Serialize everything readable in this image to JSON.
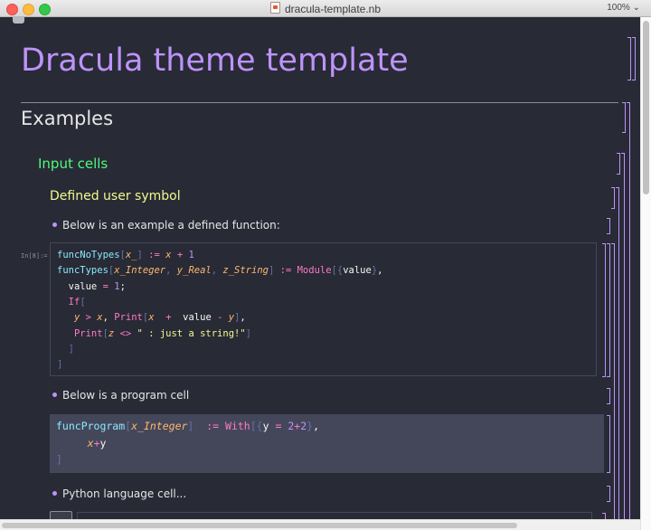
{
  "window": {
    "title": "dracula-template.nb",
    "zoom": "100%"
  },
  "notebook": {
    "title": "Dracula theme template",
    "section": "Examples",
    "subsection": "Input cells",
    "subsubsection": "Defined user symbol",
    "bullets": [
      "Below is an example a defined function:",
      "Below is a program cell",
      "Python language cell..."
    ],
    "in_label": "In[8]:="
  },
  "code1": [
    [
      [
        "fn",
        "funcNoTypes"
      ],
      [
        "gr",
        "["
      ],
      [
        "org",
        "x_"
      ],
      [
        "gr",
        "]"
      ],
      [
        "wt",
        " "
      ],
      [
        "pk",
        ":="
      ],
      [
        "wt",
        " "
      ],
      [
        "org",
        "x"
      ],
      [
        "wt",
        " "
      ],
      [
        "pk",
        "+"
      ],
      [
        "wt",
        " "
      ],
      [
        "pu",
        "1"
      ]
    ],
    [
      [
        "fn",
        "funcTypes"
      ],
      [
        "gr",
        "["
      ],
      [
        "org",
        "x_Integer"
      ],
      [
        "gr",
        ","
      ],
      [
        "wt",
        " "
      ],
      [
        "org",
        "y_Real"
      ],
      [
        "gr",
        ","
      ],
      [
        "wt",
        " "
      ],
      [
        "org",
        "z_String"
      ],
      [
        "gr",
        "]"
      ],
      [
        "wt",
        " "
      ],
      [
        "pk",
        ":="
      ],
      [
        "wt",
        " "
      ],
      [
        "pk",
        "Module"
      ],
      [
        "gr",
        "[{"
      ],
      [
        "wt",
        "value"
      ],
      [
        "gr",
        "}"
      ],
      [
        "wt",
        ","
      ]
    ],
    [
      [
        "wt",
        "  value "
      ],
      [
        "pk",
        "="
      ],
      [
        "wt",
        " "
      ],
      [
        "pu",
        "1"
      ],
      [
        "wt",
        ";"
      ]
    ],
    [
      [
        "wt",
        "  "
      ],
      [
        "pk",
        "If"
      ],
      [
        "gr",
        "["
      ]
    ],
    [
      [
        "wt",
        "   "
      ],
      [
        "org",
        "y"
      ],
      [
        "wt",
        " "
      ],
      [
        "pk",
        ">"
      ],
      [
        "wt",
        " "
      ],
      [
        "org",
        "x"
      ],
      [
        "wt",
        ", "
      ],
      [
        "pk",
        "Print"
      ],
      [
        "gr",
        "["
      ],
      [
        "org",
        "x"
      ],
      [
        "wt",
        "  "
      ],
      [
        "pk",
        "+"
      ],
      [
        "wt",
        "  value "
      ],
      [
        "pk",
        "-"
      ],
      [
        "wt",
        " "
      ],
      [
        "org",
        "y"
      ],
      [
        "gr",
        "]"
      ],
      [
        "wt",
        ","
      ]
    ],
    [
      [
        "wt",
        "   "
      ],
      [
        "pk",
        "Print"
      ],
      [
        "gr",
        "["
      ],
      [
        "org",
        "z"
      ],
      [
        "wt",
        " "
      ],
      [
        "pk",
        "<>"
      ],
      [
        "wt",
        " "
      ],
      [
        "yl",
        "\" : just a string!\""
      ],
      [
        "gr",
        "]"
      ]
    ],
    [
      [
        "wt",
        "  "
      ],
      [
        "gr",
        "]"
      ]
    ],
    [
      [
        "gr",
        "]"
      ]
    ]
  ],
  "code2": [
    [
      [
        "fn",
        "funcProgram"
      ],
      [
        "gr",
        "["
      ],
      [
        "org",
        "x_Integer"
      ],
      [
        "gr",
        "]"
      ],
      [
        "wt",
        "  "
      ],
      [
        "pk",
        ":="
      ],
      [
        "wt",
        " "
      ],
      [
        "pk",
        "With"
      ],
      [
        "gr",
        "[{"
      ],
      [
        "wt",
        "y "
      ],
      [
        "pk",
        "="
      ],
      [
        "wt",
        " "
      ],
      [
        "pu",
        "2"
      ],
      [
        "pk",
        "+"
      ],
      [
        "pu",
        "2"
      ],
      [
        "gr",
        "}"
      ],
      [
        "wt",
        ","
      ]
    ],
    [
      [
        "wt",
        "     "
      ],
      [
        "org",
        "x"
      ],
      [
        "pk",
        "+"
      ],
      [
        "wt",
        "y"
      ]
    ],
    [
      [
        "gr",
        "]"
      ]
    ]
  ],
  "colors": {
    "background": "#282a36",
    "purple": "#bd93f9",
    "green": "#50fa7b",
    "yellow": "#f1fa8c",
    "cyan": "#8be9fd",
    "pink": "#ff79c6",
    "orange": "#ffb86c",
    "comment": "#6272a4"
  }
}
